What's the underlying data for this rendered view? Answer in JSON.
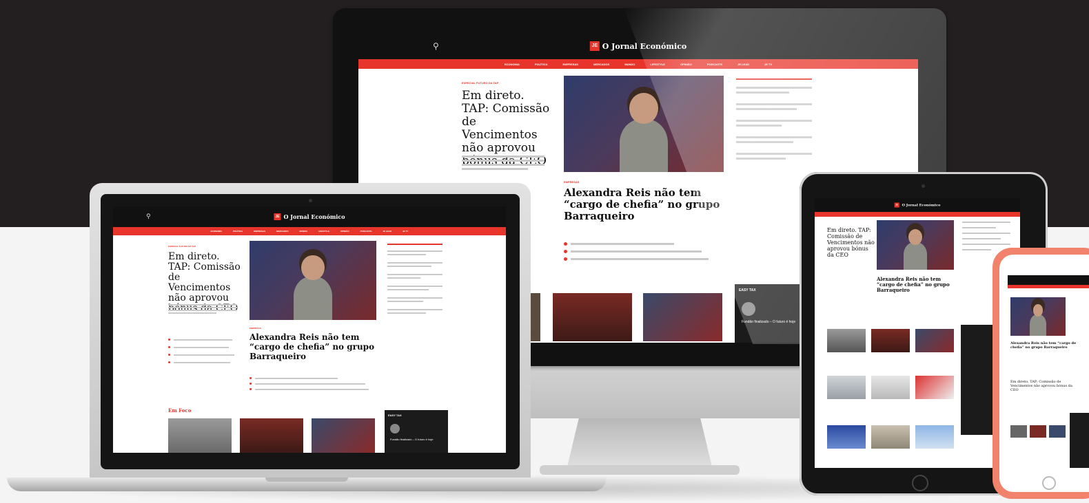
{
  "site": {
    "logo_text": "O Jornal Económico",
    "logo_mark": "JE",
    "nav_items": [
      "ECONOMIA",
      "POLÍTICA",
      "EMPRESAS",
      "MERCADOS",
      "MUNDO",
      "LIFESTYLE",
      "OPINIÃO",
      "PODCASTS",
      "JE LEAD",
      "JE TV"
    ]
  },
  "story_main": {
    "kicker": "ESPECIAL FUTURO DA TAP",
    "headline": "Em direto. TAP: Comissão de Vencimentos não aprovou bónus da CEO"
  },
  "story_second": {
    "kicker": "EMPRESAS",
    "headline": "Alexandra Reis não tem “cargo de chefia” no grupo Barraqueiro"
  },
  "section": {
    "em_foco": "Em Foco",
    "box_title": "EASY TAX",
    "box_caption": "Fundão finalizado – O futuro é hoje"
  },
  "colors": {
    "brand_red": "#e8352b",
    "backdrop_dark": "#231f20"
  },
  "icons": {
    "search": "search-icon"
  }
}
